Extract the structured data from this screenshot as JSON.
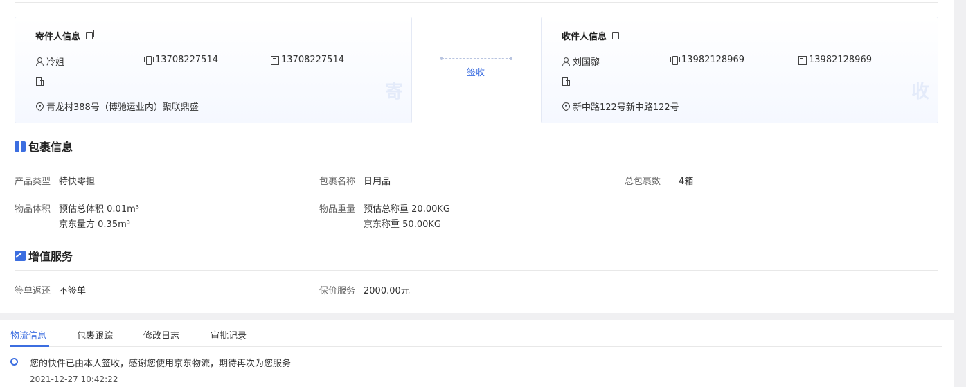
{
  "sender": {
    "title": "寄件人信息",
    "name": "冷姐",
    "mobile": "13708227514",
    "phone": "13708227514",
    "company": "",
    "address": "青龙村388号（博驰运业内）聚联鼎盛",
    "mark": "寄"
  },
  "receiver": {
    "title": "收件人信息",
    "name": "刘国黎",
    "mobile": "13982128969",
    "phone": "13982128969",
    "company": "",
    "address": "新中路122号新中路122号",
    "mark": "收"
  },
  "status": "签收",
  "package": {
    "title": "包裹信息",
    "product_type_label": "产品类型",
    "product_type": "特快零担",
    "package_name_label": "包裹名称",
    "package_name": "日用品",
    "total_count_label": "总包裹数",
    "total_count": "4箱",
    "volume_label": "物品体积",
    "volume_est": "预估总体积 0.01m³",
    "volume_jd": "京东量方 0.35m³",
    "weight_label": "物品重量",
    "weight_est": "预估总称重 20.00KG",
    "weight_jd": "京东称重 50.00KG"
  },
  "value_added": {
    "title": "增值服务",
    "sign_return_label": "签单返还",
    "sign_return": "不签单",
    "insurance_label": "保价服务",
    "insurance": "2000.00元"
  },
  "tabs": [
    {
      "label": "物流信息"
    },
    {
      "label": "包裹跟踪"
    },
    {
      "label": "修改日志"
    },
    {
      "label": "审批记录"
    }
  ],
  "timeline": [
    {
      "text": "您的快件已由本人签收，感谢您使用京东物流，期待再次为您服务",
      "time": "2021-12-27 10:42:22"
    }
  ],
  "colors": {
    "accent": "#3c6ee0"
  }
}
